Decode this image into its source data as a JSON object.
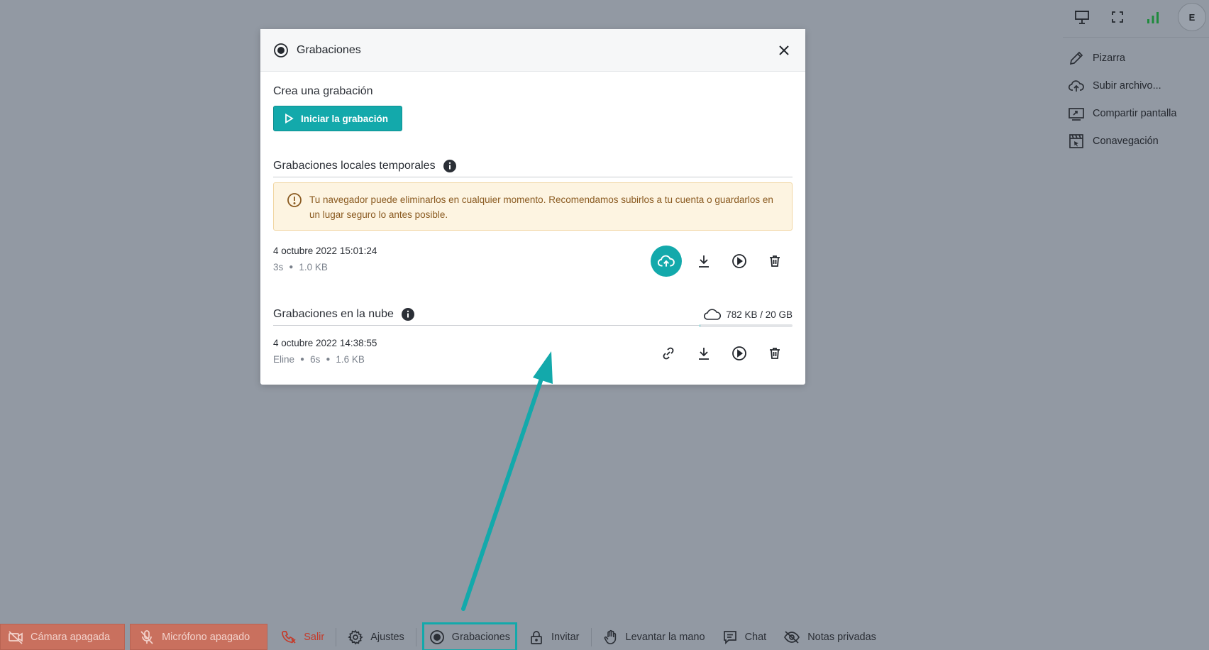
{
  "topbar": {
    "icons": [
      "presentation-icon",
      "fullscreen-icon",
      "signal-icon"
    ],
    "avatar_initial": "E"
  },
  "side_menu": [
    {
      "label": "Pizarra",
      "icon": "pencil-icon"
    },
    {
      "label": "Subir archivo...",
      "icon": "cloud-upload-icon"
    },
    {
      "label": "Compartir pantalla",
      "icon": "screen-share-icon"
    },
    {
      "label": "Conavegación",
      "icon": "cobrowse-icon"
    }
  ],
  "modal": {
    "title": "Grabaciones",
    "create_label": "Crea una grabación",
    "start_button": "Iniciar la grabación",
    "local": {
      "title": "Grabaciones locales temporales",
      "warning": "Tu navegador puede eliminarlos en cualquier momento. Recomendamos subirlos a tu cuenta o guardarlos en un lugar seguro lo antes posible.",
      "items": [
        {
          "date": "4 octubre 2022 15:01:24",
          "duration": "3s",
          "size": "1.0 KB"
        }
      ]
    },
    "cloud": {
      "title": "Grabaciones en la nube",
      "quota": "782 KB / 20 GB",
      "quota_fraction": 4e-05,
      "items": [
        {
          "owner": "Eline",
          "date": "4 octubre 2022 14:38:55",
          "duration": "6s",
          "size": "1.6 KB"
        }
      ]
    }
  },
  "bottom_bar": {
    "camera": "Cámara apagada",
    "microphone": "Micrófono apagado",
    "exit": "Salir",
    "settings": "Ajustes",
    "recordings": "Grabaciones",
    "invite": "Invitar",
    "raise_hand": "Levantar la mano",
    "chat": "Chat",
    "private_notes": "Notas privadas"
  },
  "colors": {
    "accent": "#13a9ab",
    "danger": "#c9705e",
    "warning_bg": "#fdf4e1",
    "overlay": "#9299a3"
  }
}
